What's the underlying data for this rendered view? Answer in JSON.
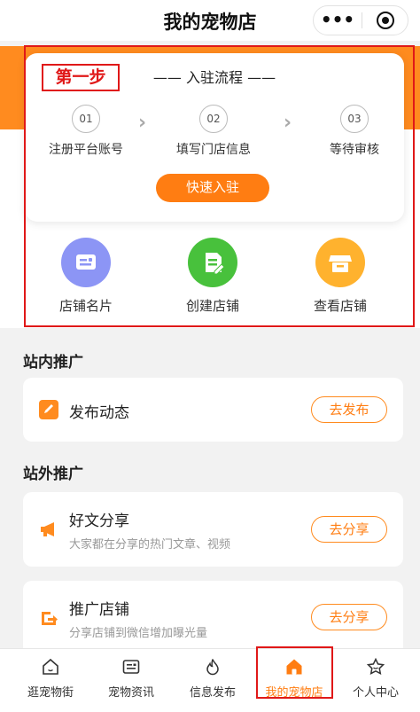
{
  "nav": {
    "title": "我的宠物店",
    "more": "•••"
  },
  "flow": {
    "step_tag": "第一步",
    "title": "—— 入驻流程 ——",
    "steps": [
      {
        "num": "01",
        "label": "注册平台账号"
      },
      {
        "num": "02",
        "label": "填写门店信息"
      },
      {
        "num": "03",
        "label": "等待审核"
      }
    ],
    "chevron": "›",
    "join_label": "快速入驻"
  },
  "quick_actions": [
    {
      "label": "店铺名片",
      "icon": "business-card-icon",
      "color": "#8c95f5"
    },
    {
      "label": "创建店铺",
      "icon": "document-edit-icon",
      "color": "#48c13c"
    },
    {
      "label": "查看店铺",
      "icon": "store-icon",
      "color": "#ffb22e"
    }
  ],
  "internal": {
    "title": "站内推广",
    "items": [
      {
        "title": "发布动态",
        "button": "去发布",
        "icon": "pencil-icon"
      }
    ]
  },
  "external": {
    "title": "站外推广",
    "items": [
      {
        "title": "好文分享",
        "desc": "大家都在分享的热门文章、视频",
        "button": "去分享",
        "icon": "megaphone-icon"
      },
      {
        "title": "推广店铺",
        "desc": "分享店铺到微信增加曝光量",
        "button": "去分享",
        "icon": "share-icon"
      }
    ]
  },
  "tabs": [
    {
      "label": "逛宠物街",
      "icon": "home-icon"
    },
    {
      "label": "宠物资讯",
      "icon": "news-icon"
    },
    {
      "label": "信息发布",
      "icon": "flame-icon"
    },
    {
      "label": "我的宠物店",
      "icon": "shop-home-icon",
      "active": true
    },
    {
      "label": "个人中心",
      "icon": "star-icon"
    }
  ],
  "colors": {
    "accent": "#ff7d12",
    "annotation": "#e01818"
  }
}
